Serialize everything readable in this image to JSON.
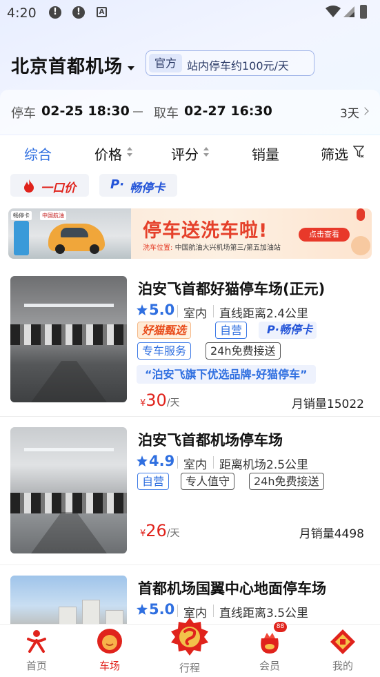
{
  "status_bar": {
    "time": "4:20",
    "alert_1": "!",
    "alert_2": "!",
    "a_badge": "A"
  },
  "header": {
    "location": "北京首都机场",
    "official_tag": "官方",
    "official_text": "站内停车约100元/天"
  },
  "time_range": {
    "park_label": "停车",
    "park_time": "02-25 18:30",
    "pick_label": "取车",
    "pick_time": "02-27 16:30",
    "duration": "3天"
  },
  "sort_tabs": [
    {
      "label": "综合",
      "active": true
    },
    {
      "label": "价格"
    },
    {
      "label": "评分"
    },
    {
      "label": "销量"
    },
    {
      "label": "筛选"
    }
  ],
  "quick_chips": [
    {
      "label": "一口价",
      "icon": "fire-icon"
    },
    {
      "label": "畅停卡",
      "prefix": "P·"
    }
  ],
  "banner": {
    "logo_1": "畅停卡",
    "logo_2": "中国航油",
    "title": "停车送洗车啦!",
    "location_label": "洗车位置:",
    "location": "中国航油大兴机场第三/第五加油站",
    "button": "点击查看"
  },
  "lots": [
    {
      "name": "泊安飞首都好猫停车场(正元)",
      "rating": "5.0",
      "type": "室内",
      "distance": "直线距离2.4公里",
      "tags_row1": [
        "好猫甄选",
        "自营",
        "畅停卡"
      ],
      "tags_row2": [
        "专车服务",
        "24h免费接送"
      ],
      "slogan": "“泊安飞旗下优选品牌-好猫停车”",
      "currency": "¥",
      "price": "30",
      "unit": "/天",
      "sales": "月销量15022"
    },
    {
      "name": "泊安飞首都机场停车场",
      "rating": "4.9",
      "type": "室内",
      "distance": "距离机场2.5公里",
      "tags_row1": [
        "自营",
        "专人值守",
        "24h免费接送"
      ],
      "currency": "¥",
      "price": "26",
      "unit": "/天",
      "sales": "月销量4498"
    },
    {
      "name": "首都机场国翼中心地面停车场",
      "rating": "5.0",
      "type": "室内",
      "distance": "直线距离3.5公里"
    }
  ],
  "tabbar": {
    "items": [
      {
        "label": "首页",
        "icon": "home-logo-icon"
      },
      {
        "label": "车场",
        "icon": "parking-mascot-icon",
        "active": true
      },
      {
        "label": "行程",
        "icon": "trip-icon"
      },
      {
        "label": "会员",
        "icon": "member-bag-icon",
        "badge": "88"
      },
      {
        "label": "我的",
        "icon": "profile-diamond-icon"
      }
    ]
  },
  "colors": {
    "accent_blue": "#2f6fe0",
    "price_red": "#e0231c"
  }
}
